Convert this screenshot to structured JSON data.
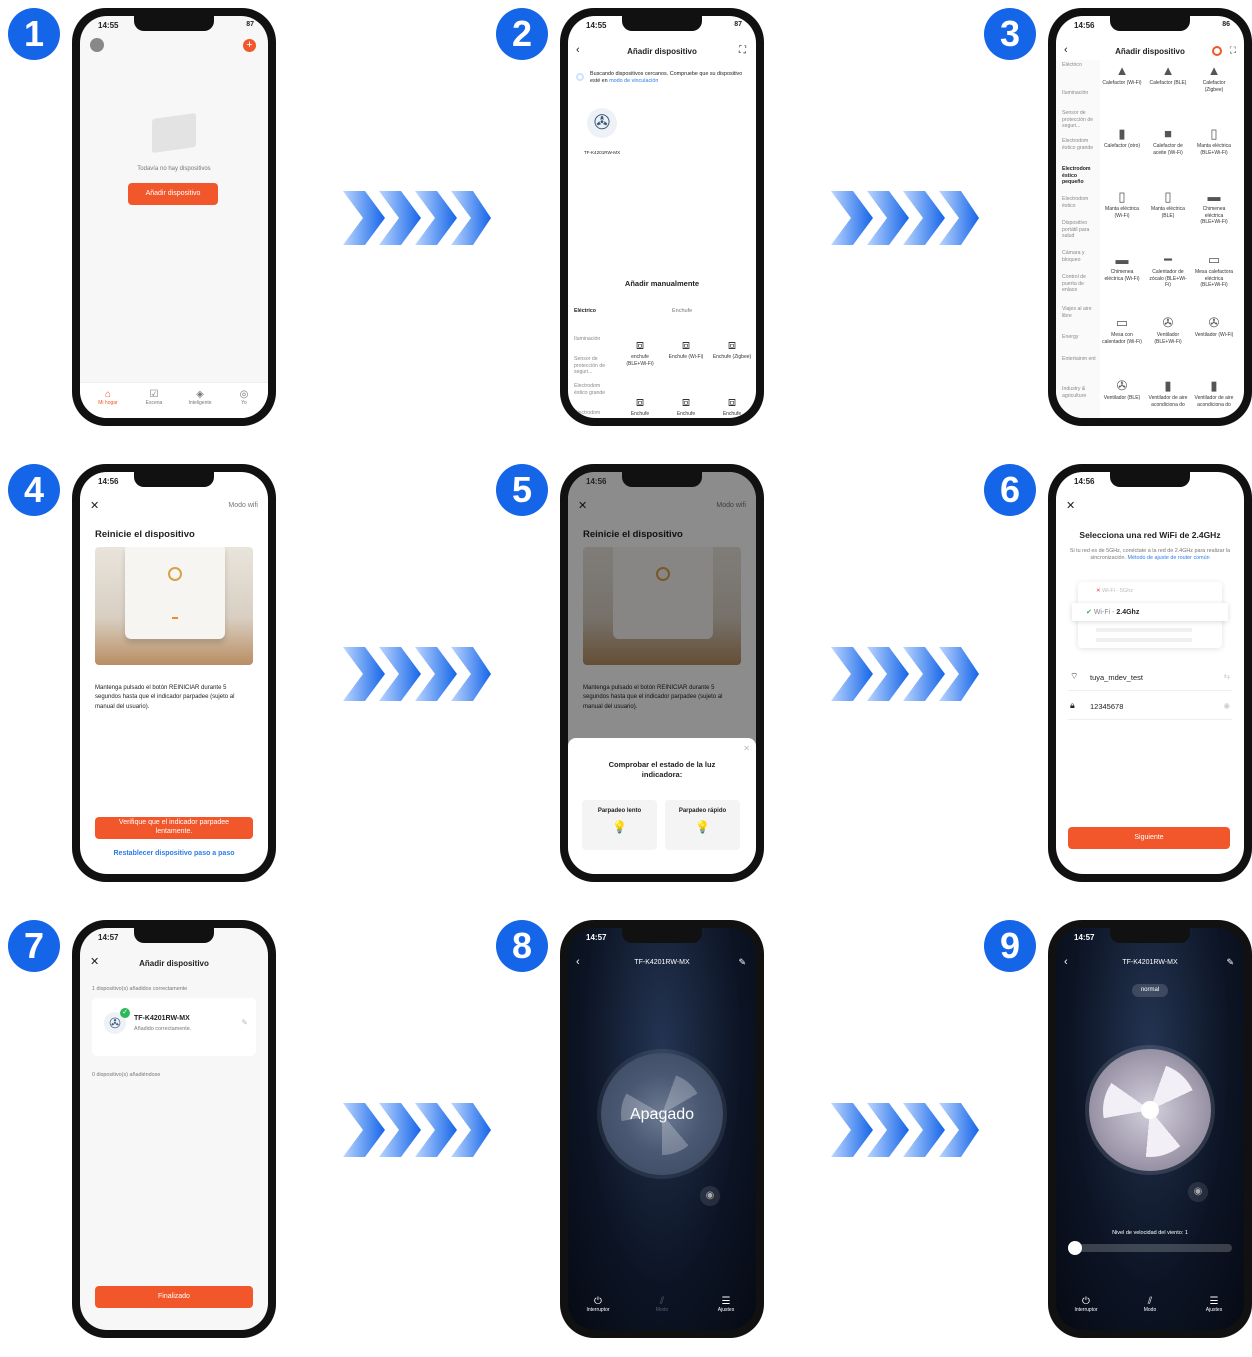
{
  "steps": [
    "1",
    "2",
    "3",
    "4",
    "5",
    "6",
    "7",
    "8",
    "9"
  ],
  "s1": {
    "time": "14:55",
    "status": "87",
    "empty_text": "Todavía no hay dispositivos",
    "add_button": "Añadir dispositivo",
    "tabs": [
      "Mi hogar",
      "Escena",
      "Inteligente",
      "Yo"
    ]
  },
  "s2": {
    "time": "14:55",
    "status": "87",
    "title": "Añadir dispositivo",
    "searching": "Buscando dispositivos cercanos. Compruebe que su dispositivo esté en",
    "searching_link": "modo de vinculación",
    "device": "TF-K4201RW-MX",
    "manual_title": "Añadir manualmente",
    "cats": [
      "Eléctrico",
      "Iluminación",
      "Sensor de protección de seguri...",
      "Electrodom éstico grande",
      "Electrodom"
    ],
    "col_header": "Enchufe",
    "tiles": [
      "enchufe (BLE+Wi-Fi)",
      "Enchufe (Wi-Fi)",
      "Enchufe (Zigbee)",
      "Enchufe",
      "Enchufe",
      "Enchufe"
    ]
  },
  "s3": {
    "time": "14:56",
    "status": "86",
    "title": "Añadir dispositivo",
    "cats": [
      "Eléctrico",
      "Iluminación",
      "Sensor de protección de seguri...",
      "Electrodom éstico grande",
      "Electrodom éstico pequeño",
      "Electrodom éstico",
      "Dispositivo portátil para salud",
      "Cámara y bloqueo",
      "Control de puerta de enlace",
      "Viajes al aire libre",
      "Energy",
      "Entertainm ent",
      "Industry & agriculture"
    ],
    "tiles": [
      "Calefactor (Wi-Fi)",
      "Calefactor (BLE)",
      "Calefactor (Zigbee)",
      "Calefactor (otro)",
      "Calefactor de aceite (Wi-Fi)",
      "Manta eléctrica (BLE+Wi-Fi)",
      "Manta eléctrica (Wi-Fi)",
      "Manta eléctrica (BLE)",
      "Chimenea eléctrica (BLE+Wi-Fi)",
      "Chimenea eléctrica (Wi-Fi)",
      "Calentador de zócalo (BLE+Wi-Fi)",
      "Mesa calefactora eléctrica (BLE+Wi-Fi)",
      "Mesa con calentador (Wi-Fi)",
      "Ventilador (BLE+Wi-Fi)",
      "Ventilador (Wi-Fi)",
      "Ventilador (BLE)",
      "Ventilador de aire acondiciona do",
      "Ventilador de aire acondiciona do"
    ]
  },
  "s4": {
    "time": "14:56",
    "mode": "Modo wifi",
    "title": "Reinicie el dispositivo",
    "desc": "Mantenga pulsado el botón REINICIAR durante 5 segundos hasta que el indicador parpadee (sujeto al manual del usuario).",
    "confirm": "Verifique que el indicador parpadee lentamente.",
    "reset_link": "Restablecer dispositivo paso a paso"
  },
  "s5": {
    "time": "14:56",
    "mode": "Modo wifi",
    "title": "Reinicie el dispositivo",
    "desc": "Mantenga pulsado el botón REINICIAR durante 5 segundos hasta que el indicador parpadee (sujeto al manual del usuario).",
    "sheet_title": "Comprobar el estado de la luz indicadora:",
    "slow": "Parpadeo lento",
    "fast": "Parpadeo rápido"
  },
  "s6": {
    "time": "14:56",
    "title": "Selecciona una red WiFi de 2.4GHz",
    "desc": "Si tu red es de 5GHz, conéctate a la red de 2.4GHz para realizar la sincronización.",
    "desc_link": "Método de ajuste de router común",
    "net5": "Wi-Fi - 5Ghz",
    "net24_prefix": "Wi-Fi - ",
    "net24_band": "2.4Ghz",
    "ssid": "tuya_mdev_test",
    "password": "12345678",
    "next": "Siguiente"
  },
  "s7": {
    "time": "14:57",
    "title": "Añadir dispositivo",
    "added_count": "1 dispositivo(s) añadidos correctamente",
    "device": "TF-K4201RW-MX",
    "device_status": "Añadido correctamente.",
    "adding": "0 dispositivo(s) añadiéndose",
    "done": "Finalizado"
  },
  "s8": {
    "time": "14:57",
    "title": "TF-K4201RW-MX",
    "state": "Apagado",
    "bottom": [
      "Interruptor",
      "Modo",
      "Ajustes"
    ]
  },
  "s9": {
    "time": "14:57",
    "title": "TF-K4201RW-MX",
    "mode_chip": "normal",
    "speed_label": "Nivel de velocidad del viento: 1",
    "speed_value": 1,
    "bottom": [
      "Interruptor",
      "Modo",
      "Ajustes"
    ]
  },
  "colors": {
    "accent": "#f2572b",
    "step_blue": "#1565e8",
    "link": "#2b7ce8"
  }
}
